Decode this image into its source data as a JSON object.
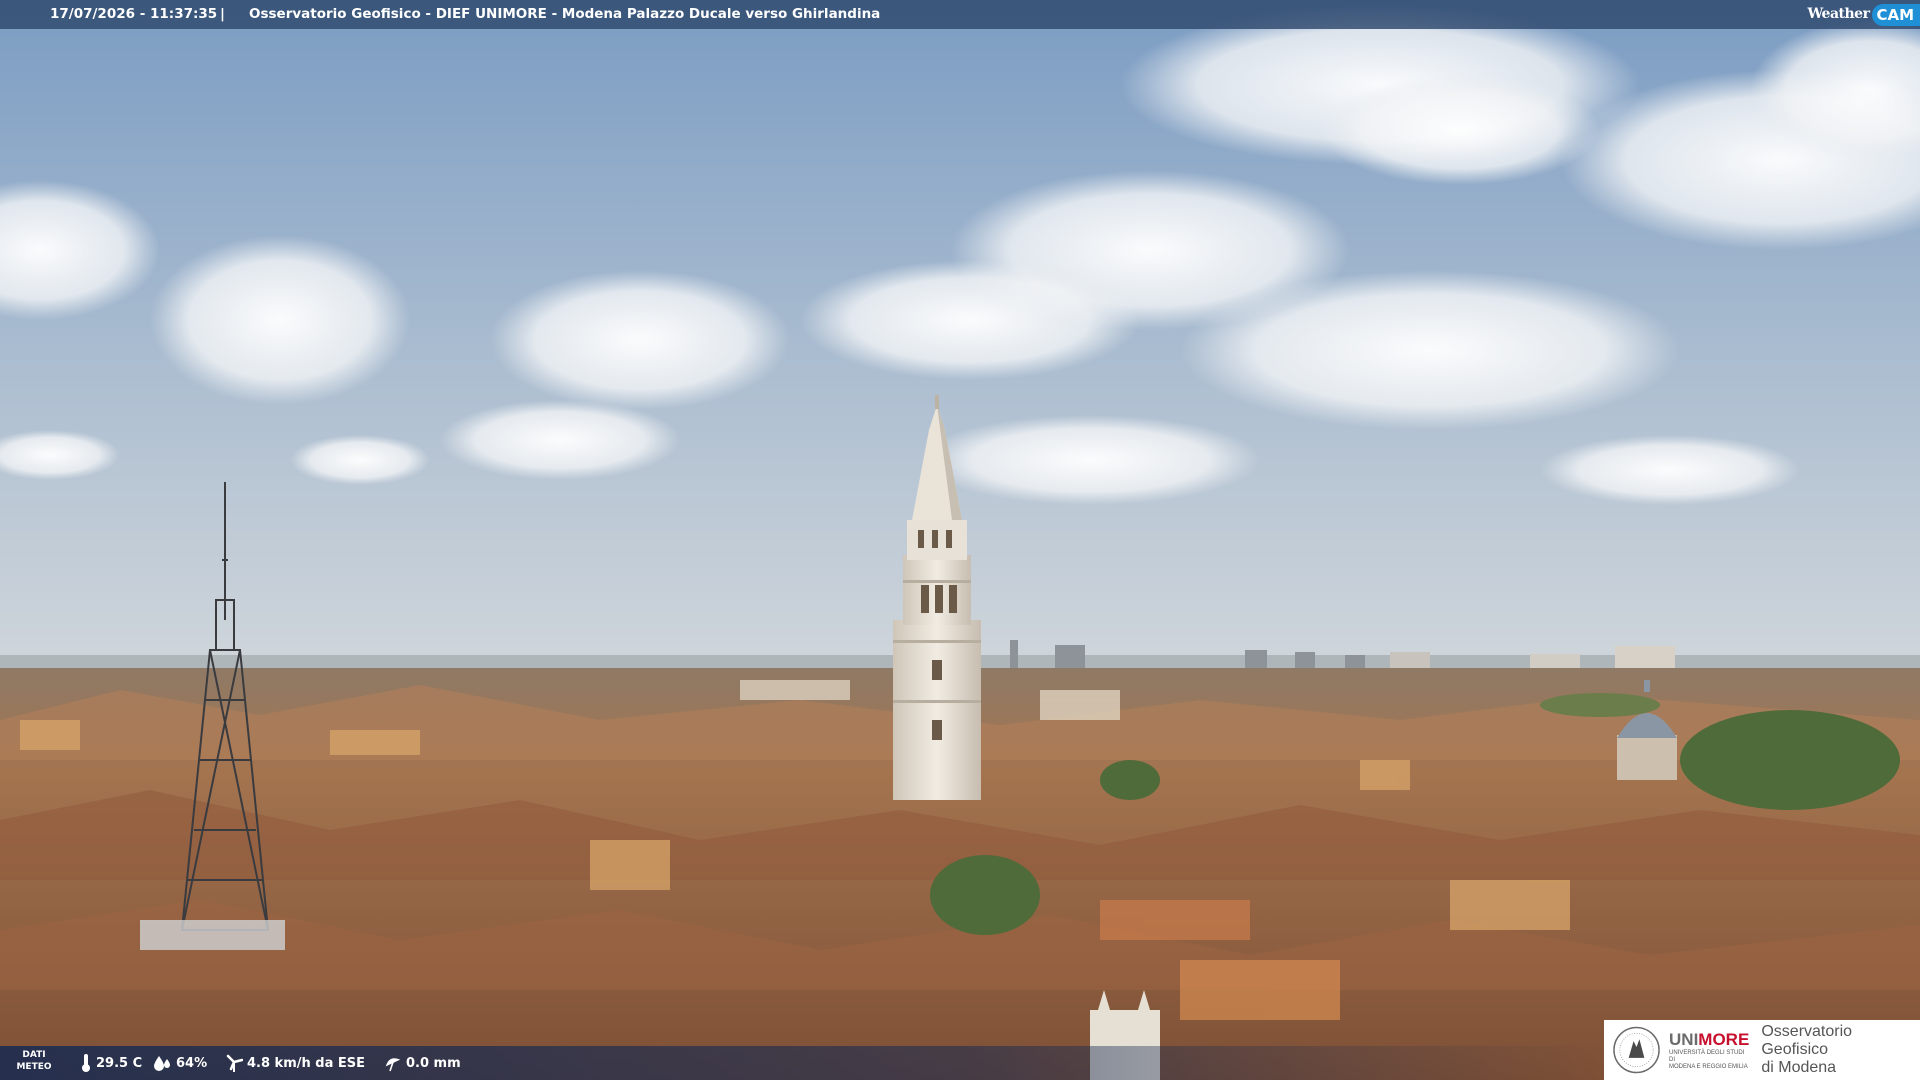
{
  "header": {
    "timestamp": "17/07/2026 - 11:37:35",
    "separator": "|",
    "title": "Osservatorio Geofisico - DIEF UNIMORE - Modena Palazzo Ducale verso Ghirlandina"
  },
  "brand": {
    "weather": "Weather",
    "cam": "CAM"
  },
  "weather_bar": {
    "label_line1": "DATI",
    "label_line2": "METEO",
    "temperature": "29.5 C",
    "humidity": "64%",
    "wind": "4.8 km/h da ESE",
    "rain": "0.0 mm"
  },
  "logo": {
    "university": "UNIMORE",
    "university_sub1": "UNIVERSITÀ DEGLI STUDI DI",
    "university_sub2": "MODENA E REGGIO EMILIA",
    "observatory_line1": "Osservatorio Geofisico",
    "observatory_line2": "di Modena"
  },
  "scene": {
    "sky_top": "#7f9fc4",
    "sky_horizon": "#c9d3dc",
    "roof_color": "#b07a55",
    "tower_color": "#ece6dc"
  }
}
